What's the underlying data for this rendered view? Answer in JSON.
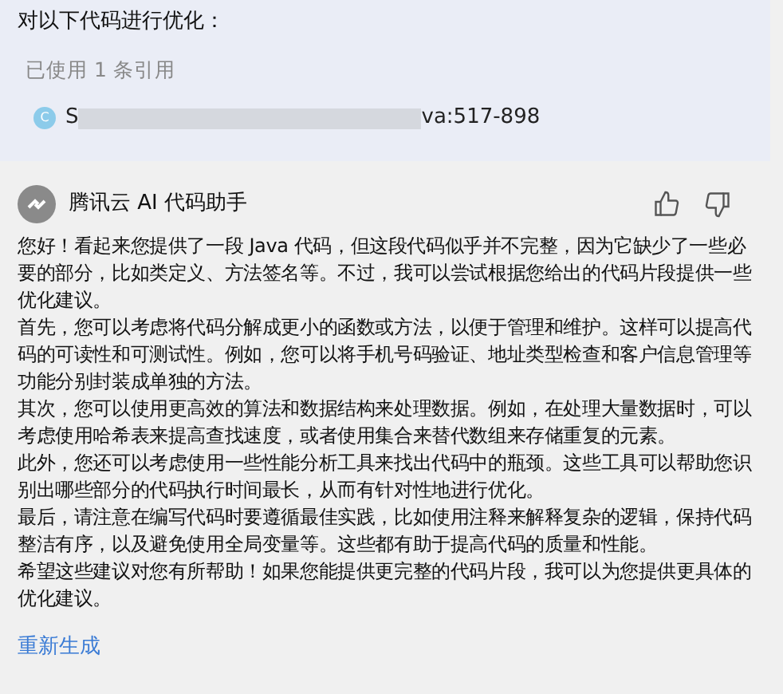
{
  "prompt": "对以下代码进行优化：",
  "references": {
    "summary": "已使用 1 条引用",
    "items": [
      {
        "icon": "C",
        "start": "S",
        "end": "va:517-898"
      }
    ]
  },
  "assistant": {
    "name": "腾讯云 AI 代码助手",
    "liked": false,
    "disliked": false,
    "paragraphs": [
      "您好！看起来您提供了一段 Java 代码，但这段代码似乎并不完整，因为它缺少了一些必要的部分，比如类定义、方法签名等。不过，我可以尝试根据您给出的代码片段提供一些优化建议。",
      "首先，您可以考虑将代码分解成更小的函数或方法，以便于管理和维护。这样可以提高代码的可读性和可测试性。例如，您可以将手机号码验证、地址类型检查和客户信息管理等功能分别封装成单独的方法。",
      "其次，您可以使用更高效的算法和数据结构来处理数据。例如，在处理大量数据时，可以考虑使用哈希表来提高查找速度，或者使用集合来替代数组来存储重复的元素。",
      "此外，您还可以考虑使用一些性能分析工具来找出代码中的瓶颈。这些工具可以帮助您识别出哪些部分的代码执行时间最长，从而有针对性地进行优化。",
      "最后，请注意在编写代码时要遵循最佳实践，比如使用注释来解释复杂的逻辑，保持代码整洁有序，以及避免使用全局变量等。这些都有助于提高代码的质量和性能。",
      "希望这些建议对您有所帮助！如果您能提供更完整的代码片段，我可以为您提供更具体的优化建议。"
    ],
    "regenerate": "重新生成"
  }
}
